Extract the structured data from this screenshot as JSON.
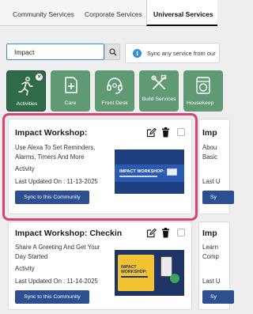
{
  "tabs": [
    {
      "label": "Community Services"
    },
    {
      "label": "Corporate Services"
    },
    {
      "label": "Universal Services"
    }
  ],
  "search": {
    "value": "Impact"
  },
  "info": {
    "text": "Sync any service from our"
  },
  "categories": [
    {
      "label": "Activities",
      "icon": "running-person-icon",
      "selected": true
    },
    {
      "label": "Care",
      "icon": "medical-plus-icon"
    },
    {
      "label": "Front Desk",
      "icon": "headset-icon"
    },
    {
      "label": "Build Services",
      "icon": "tools-icon"
    },
    {
      "label": "Housekeep",
      "icon": "washing-machine-icon"
    }
  ],
  "cards": [
    {
      "title": "Impact Workshop:",
      "desc_line1": "Use Alexa To Set Reminders,",
      "desc_line2": "Alarms, Timers And More",
      "type": "Activity",
      "date": "Last Updated On : 11-13-2025",
      "sync_label": "Sync to this Community",
      "thumb_title": "IMPACT WORKSHOP:"
    },
    {
      "title": "Impact Workshop: Checkin",
      "desc_line1": "Share A Greeting And Get Your",
      "desc_line2": "Day Started",
      "type": "Activity",
      "date": "Last Updated On : 11-14-2025",
      "sync_label": "Sync to this Community",
      "thumb_title": "IMPACT WORKSHOP:"
    },
    {
      "title": "Imp",
      "desc_line1": "Abou",
      "desc_line2": "Basic",
      "date": "Last U",
      "sync_label": "Sy"
    },
    {
      "title": "Imp",
      "desc_line1": "Learn",
      "desc_line2": "Comp",
      "date": "Last U",
      "sync_label": "Sy"
    }
  ],
  "colors": {
    "accent": "#2c4f92",
    "tile_green": "#5f9a74",
    "tile_selected": "#2f6b48",
    "highlight": "#d9456a"
  }
}
